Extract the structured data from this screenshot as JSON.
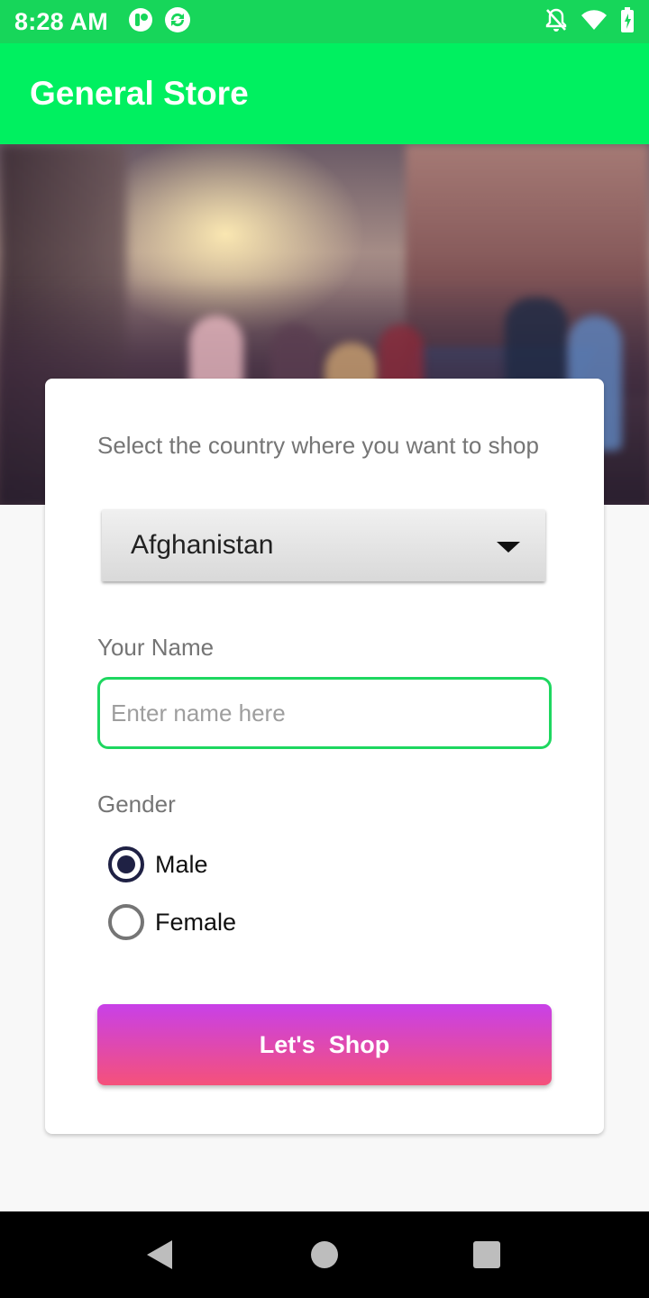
{
  "status_bar": {
    "time": "8:28 AM",
    "left_icons": [
      "app-notification-icon",
      "sync-app-icon"
    ],
    "right_icons": [
      "notifications-off-icon",
      "wifi-icon",
      "battery-charging-icon"
    ],
    "wifi_badge": "5"
  },
  "app_bar": {
    "title": "General Store",
    "color": "#00f060"
  },
  "form": {
    "country_label": "Select the country where you want to shop",
    "country_selected": "Afghanistan",
    "name_label": "Your Name",
    "name_value": "",
    "name_placeholder": "Enter name here",
    "gender_label": "Gender",
    "gender_options": [
      {
        "label": "Male",
        "checked": true
      },
      {
        "label": "Female",
        "checked": false
      }
    ],
    "submit_label": "Let's  Shop"
  },
  "colors": {
    "status_bar": "#17d65a",
    "accent_input_border": "#1ed760",
    "radio_checked": "#1f2144",
    "button_gradient_top": "#c840e8",
    "button_gradient_bottom": "#f5517a"
  },
  "nav_bar": {
    "buttons": [
      "back-icon",
      "home-icon",
      "recents-icon"
    ]
  }
}
